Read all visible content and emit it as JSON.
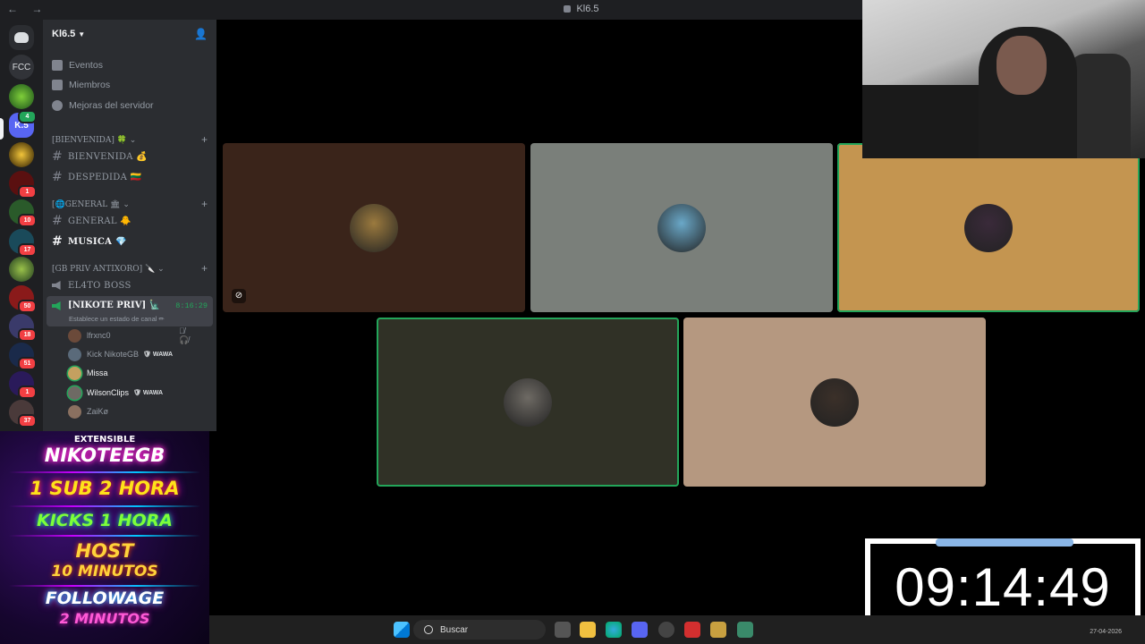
{
  "window": {
    "title": "Kl6.5",
    "nav": "← →"
  },
  "server": {
    "name": "Kl6.5"
  },
  "rail": {
    "fcc": "FCC",
    "k5": "K.5",
    "badges": [
      "4",
      "1",
      "10",
      "17",
      "50",
      "18",
      "51",
      "1",
      "37"
    ]
  },
  "menu": {
    "events": "Eventos",
    "members": "Miembros",
    "boosts": "Mejoras del servidor"
  },
  "categories": {
    "welcome": "[BIENVENIDA] 🍀 ⌄",
    "general": "[🌐GENERAL 🏛 ⌄",
    "gbpriv": "[GB PRIV ANTIXORO] 🔪 ⌄"
  },
  "channels": {
    "bienvenida": "BIENVENIDA 💰",
    "despedida": "DESPEDIDA 🇱🇹",
    "general": "GENERAL 🐥",
    "musica": "MUSICA 💎",
    "boss": "EL4TO BOSS"
  },
  "voice": {
    "name": "[NIKOTE PRIV] 🗽",
    "status": "Establece un estado de canal ✏",
    "time": "8:16:29",
    "members": [
      {
        "name": "lfrxnc0",
        "tag": "",
        "bright": false,
        "muted": "🎙̸ 🎧̸"
      },
      {
        "name": "Kick NikoteGB",
        "tag": "🛡 WAWA",
        "bright": false,
        "muted": ""
      },
      {
        "name": "Missa",
        "tag": "",
        "bright": true,
        "muted": ""
      },
      {
        "name": "WilsonClips",
        "tag": "🛡 WAWA",
        "bright": true,
        "muted": ""
      },
      {
        "name": "ZaiKø",
        "tag": "",
        "bright": false,
        "muted": ""
      }
    ]
  },
  "promo": {
    "l0": "EXTENSIBLE",
    "l1": "NIKOTEEGB",
    "l2": "1 SUB 2 HORA",
    "l3": "KICKS 1 HORA",
    "l4": "HOST",
    "l5": "10 MINUTOS",
    "l6": "FOLLOWAGE",
    "l7": "2 MINUTOS"
  },
  "tiles": [
    {
      "color": "#3a241a",
      "avatar": "#9b7a3e",
      "speaking": false
    },
    {
      "color": "#7a7f7a",
      "avatar": "#6aa8c8",
      "speaking": false
    },
    {
      "color": "#c49550",
      "avatar": "#3a2a3a",
      "speaking": true
    },
    {
      "color": "#303126",
      "avatar": "#6e6a64",
      "speaking": true
    },
    {
      "color": "#b59880",
      "avatar": "#3b3029",
      "speaking": false
    }
  ],
  "timer": {
    "value": "09:14:49"
  },
  "taskbar": {
    "search": "Buscar",
    "date": "27-04-2026"
  },
  "colors": {
    "speaking": "#23a55a",
    "accent": "#5865f2",
    "badge": "#f23f43"
  }
}
